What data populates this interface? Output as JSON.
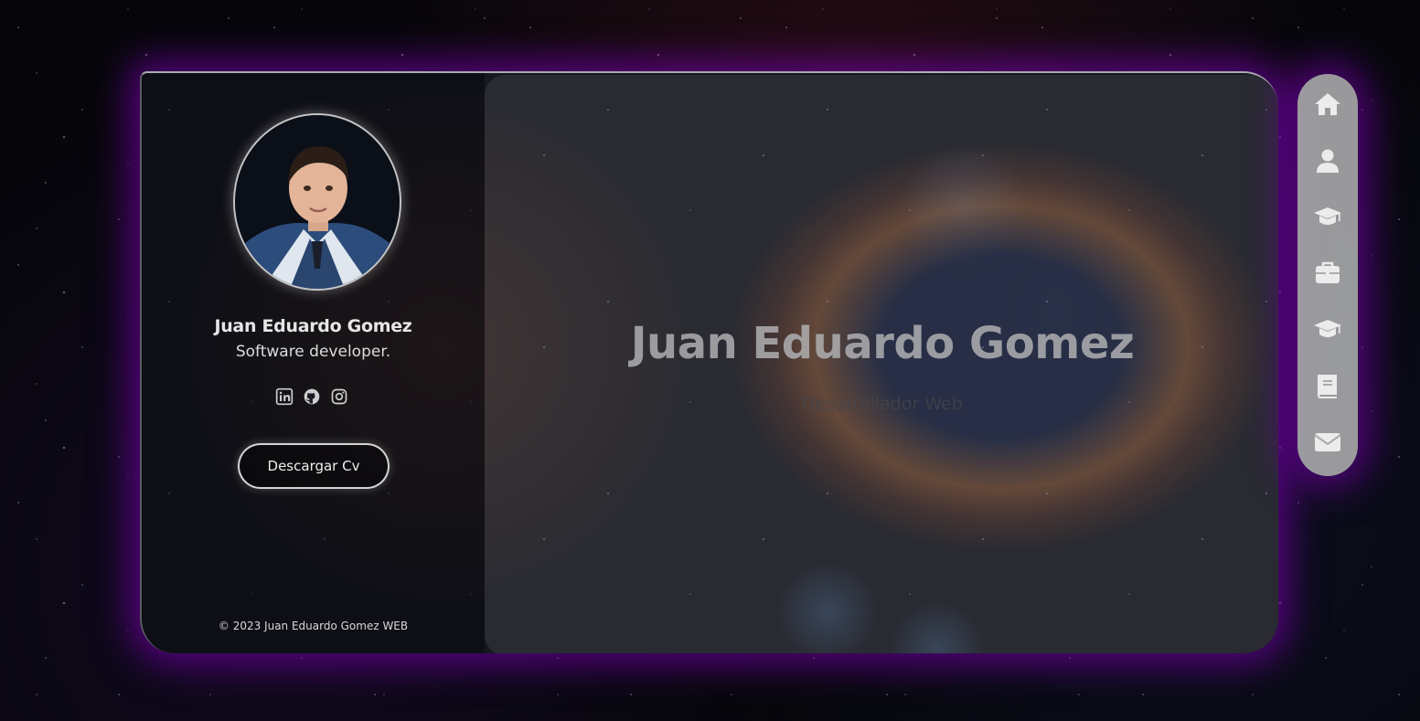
{
  "profile": {
    "name": "Juan Eduardo Gomez",
    "role": "Software developer.",
    "socials": [
      {
        "icon": "linkedin-icon"
      },
      {
        "icon": "github-icon"
      },
      {
        "icon": "instagram-icon"
      }
    ],
    "cv_button_label": "Descargar Cv",
    "footer": "© 2023 Juan Eduardo Gomez WEB"
  },
  "hero": {
    "title": "Juan Eduardo Gomez",
    "subtitle": "Desarrollador Web"
  },
  "nav": {
    "items": [
      {
        "icon": "home-icon"
      },
      {
        "icon": "user-icon"
      },
      {
        "icon": "graduation-cap-icon"
      },
      {
        "icon": "briefcase-icon"
      },
      {
        "icon": "graduation-cap-icon"
      },
      {
        "icon": "book-icon"
      },
      {
        "icon": "envelope-icon"
      }
    ]
  },
  "colors": {
    "glow": "#6e00a0",
    "nav_bg": "#aaaaac",
    "text": "#e6e6e6"
  }
}
